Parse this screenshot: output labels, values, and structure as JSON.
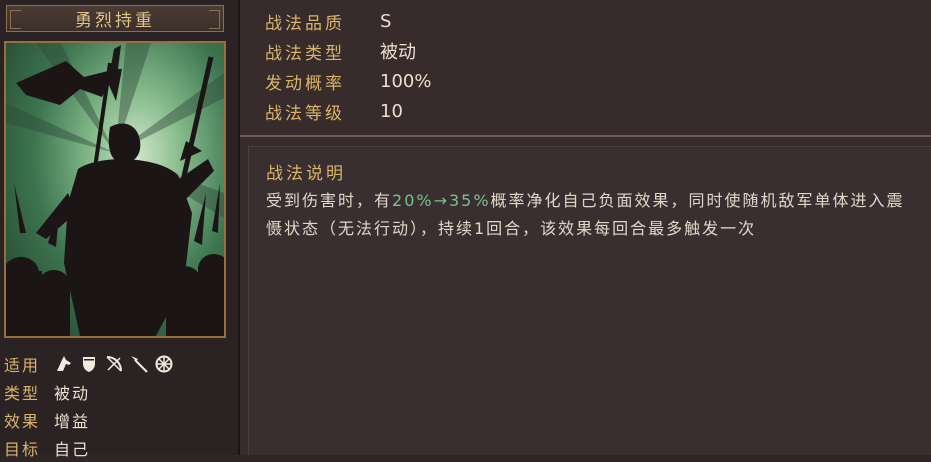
{
  "skill": {
    "name": "勇烈持重"
  },
  "properties": {
    "applicable_label": "适用",
    "troop_icons": [
      "cavalry-icon",
      "shield-icon",
      "bow-icon",
      "spear-icon",
      "siege-wheel-icon"
    ],
    "type_label": "类型",
    "type_value": "被动",
    "effect_label": "效果",
    "effect_value": "增益",
    "target_label": "目标",
    "target_value": "自己"
  },
  "info": {
    "quality_label": "战法品质",
    "quality_value": "S",
    "kind_label": "战法类型",
    "kind_value": "被动",
    "rate_label": "发动概率",
    "rate_value": "100%",
    "level_label": "战法等级",
    "level_value": "10"
  },
  "description": {
    "title": "战法说明",
    "part1": "受到伤害时，有",
    "highlight": "20%→35%",
    "part2": "概率净化自己负面效果，同时使随机敌军单体进入震慑状态（无法行动），持续1回合，该效果每回合最多触发一次"
  },
  "colors": {
    "label_gold": "#d9b469",
    "highlight_green": "#76c48a",
    "text_light": "#ecdfd0"
  }
}
